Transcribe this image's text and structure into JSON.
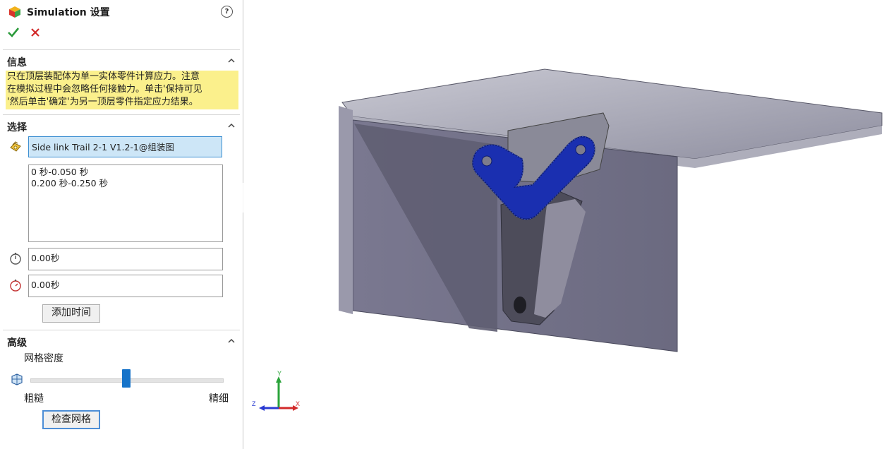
{
  "panel": {
    "title": "Simulation 设置",
    "help": "?",
    "sections": {
      "info": {
        "header": "信息",
        "lines": [
          "只在顶层装配体为单一实体零件计算应力。注意",
          "在模拟过程中会忽略任何接触力。单击'保持可见",
          "'然后单击'确定'为另一顶层零件指定应力结果。"
        ]
      },
      "selection": {
        "header": "选择",
        "selected_component": "Side link Trail 2-1 V1.2-1@组装图",
        "time_ranges": [
          "0 秒-0.050 秒",
          "0.200 秒-0.250 秒"
        ],
        "start_time": "0.00秒",
        "end_time": "0.00秒",
        "add_time_label": "添加时间"
      },
      "advanced": {
        "header": "高级",
        "mesh_density_label": "网格密度",
        "coarse_label": "粗糙",
        "fine_label": "精细",
        "mesh_density_value": 0.5,
        "check_mesh_label": "检查网格"
      }
    }
  },
  "viewport": {
    "triad": {
      "y": "Y",
      "x": "X",
      "z": "Z"
    }
  },
  "colors": {
    "info_bg": "#fbf08c",
    "selection_bg": "#cde6f7",
    "slider_thumb": "#1673c9",
    "mesh_blue": "#1a2fb0"
  }
}
